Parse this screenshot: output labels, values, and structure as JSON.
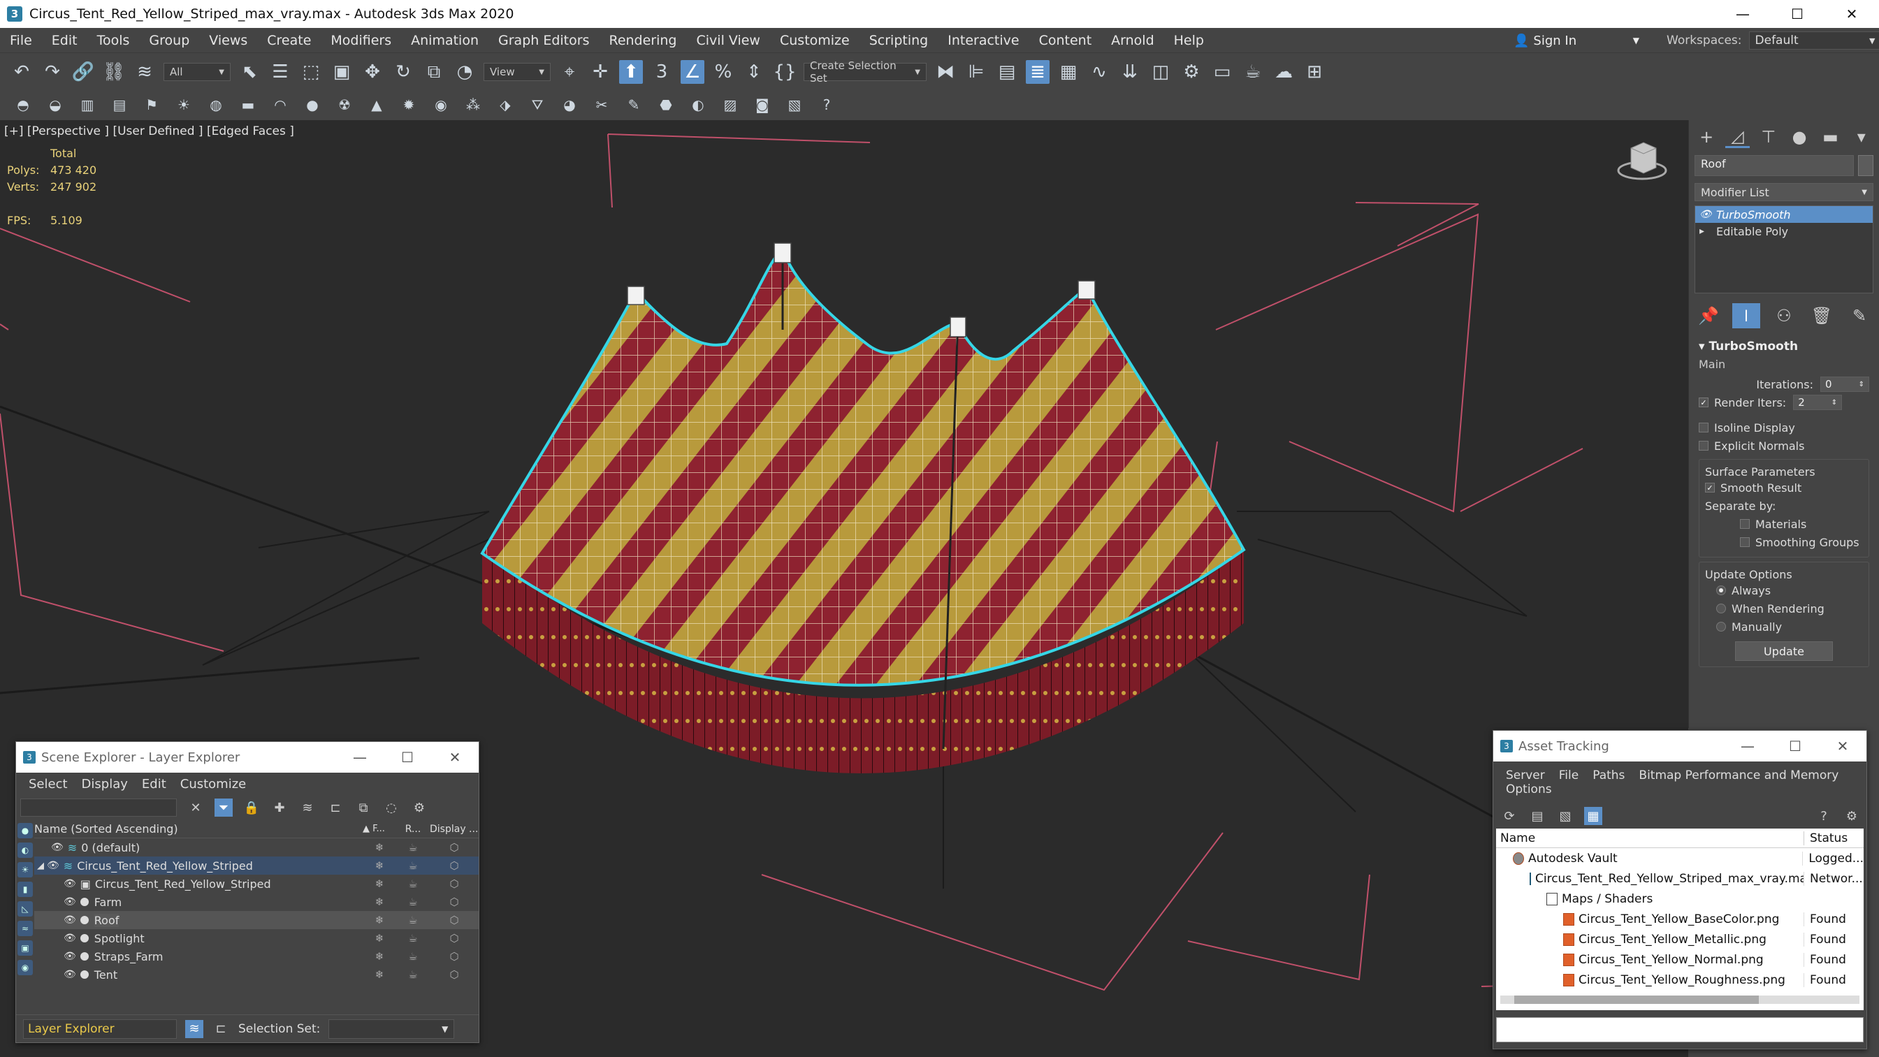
{
  "window": {
    "title": "Circus_Tent_Red_Yellow_Striped_max_vray.max - Autodesk 3ds Max 2020",
    "app_icon": "3",
    "minimize": "—",
    "maximize": "☐",
    "close": "✕"
  },
  "menu": [
    "File",
    "Edit",
    "Tools",
    "Group",
    "Views",
    "Create",
    "Modifiers",
    "Animation",
    "Graph Editors",
    "Rendering",
    "Civil View",
    "Customize",
    "Scripting",
    "Interactive",
    "Content",
    "Arnold",
    "Help"
  ],
  "signin": {
    "label": "Sign In"
  },
  "workspaces": {
    "label": "Workspaces:",
    "value": "Default"
  },
  "toolbar": {
    "filter": "All",
    "ref_coord": "View",
    "create_selection_set": "Create Selection Set",
    "angle_snap_label": "3",
    "spinner_snap_label": "%"
  },
  "viewport": {
    "label": "[+] [Perspective ] [User Defined ] [Edged Faces ]",
    "stats": {
      "total_label": "Total",
      "polys_label": "Polys:",
      "polys": "473 420",
      "verts_label": "Verts:",
      "verts": "247 902",
      "fps_label": "FPS:",
      "fps": "5.109"
    }
  },
  "command_panel": {
    "object_name": "Roof",
    "modifier_list": "Modifier List",
    "stack": [
      {
        "label": "TurboSmooth",
        "selected": true
      },
      {
        "label": "Editable Poly",
        "selected": false
      }
    ],
    "rollout": {
      "title": "TurboSmooth",
      "main": "Main",
      "iterations_label": "Iterations:",
      "iterations": "0",
      "render_iters_label": "Render Iters:",
      "render_iters": "2",
      "isoline": "Isoline Display",
      "explicit_normals": "Explicit Normals",
      "surface_params": "Surface Parameters",
      "smooth_result": "Smooth Result",
      "separate_by": "Separate by:",
      "materials": "Materials",
      "smoothing_groups": "Smoothing Groups",
      "update_options": "Update Options",
      "always": "Always",
      "when_rendering": "When Rendering",
      "manually": "Manually",
      "update": "Update"
    }
  },
  "scene_explorer": {
    "title": "Scene Explorer - Layer Explorer",
    "menu": [
      "Select",
      "Display",
      "Edit",
      "Customize"
    ],
    "columns": {
      "name": "Name (Sorted Ascending)",
      "f": "▲ F...",
      "r": "R...",
      "display": "Display ..."
    },
    "rows": [
      {
        "name": "0 (default)",
        "indent": 1,
        "kind": "layer"
      },
      {
        "name": "Circus_Tent_Red_Yellow_Striped",
        "indent": 1,
        "kind": "layer-selected"
      },
      {
        "name": "Circus_Tent_Red_Yellow_Striped",
        "indent": 2,
        "kind": "object"
      },
      {
        "name": "Farm",
        "indent": 2,
        "kind": "object"
      },
      {
        "name": "Roof",
        "indent": 2,
        "kind": "object-hl"
      },
      {
        "name": "Spotlight",
        "indent": 2,
        "kind": "object"
      },
      {
        "name": "Straps_Farm",
        "indent": 2,
        "kind": "object"
      },
      {
        "name": "Tent",
        "indent": 2,
        "kind": "object"
      }
    ],
    "footer": {
      "explorer": "Layer Explorer",
      "selection_set_label": "Selection Set:"
    }
  },
  "asset_tracking": {
    "title": "Asset Tracking",
    "menu": [
      "Server",
      "File",
      "Paths",
      "Bitmap Performance and Memory",
      "Options"
    ],
    "columns": {
      "name": "Name",
      "status": "Status"
    },
    "rows": [
      {
        "name": "Autodesk Vault",
        "status": "Logged...",
        "indent": 0,
        "icon": "vault"
      },
      {
        "name": "Circus_Tent_Red_Yellow_Striped_max_vray.max",
        "status": "Networ...",
        "indent": 1,
        "icon": "max"
      },
      {
        "name": "Maps / Shaders",
        "status": "",
        "indent": 2,
        "icon": "folder"
      },
      {
        "name": "Circus_Tent_Yellow_BaseColor.png",
        "status": "Found",
        "indent": 3,
        "icon": "png"
      },
      {
        "name": "Circus_Tent_Yellow_Metallic.png",
        "status": "Found",
        "indent": 3,
        "icon": "png"
      },
      {
        "name": "Circus_Tent_Yellow_Normal.png",
        "status": "Found",
        "indent": 3,
        "icon": "png"
      },
      {
        "name": "Circus_Tent_Yellow_Roughness.png",
        "status": "Found",
        "indent": 3,
        "icon": "png"
      }
    ]
  },
  "colors": {
    "accent": "#5b8fc7",
    "tent_red": "#8e2230",
    "tent_yellow": "#b89a3c",
    "selection_outline": "#36d6e6",
    "grid_line": "#c0506a"
  }
}
